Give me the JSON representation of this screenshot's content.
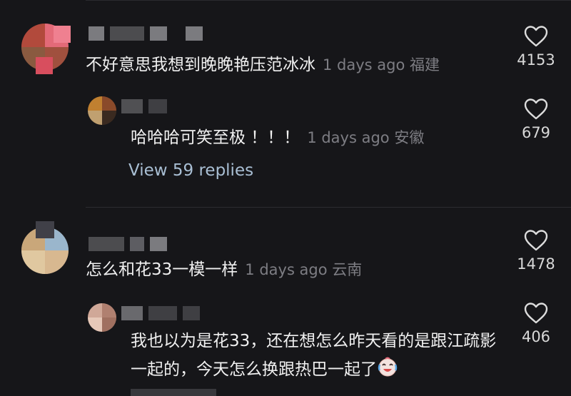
{
  "comments": [
    {
      "text": "不好意思我想到晚晚艳压范冰冰",
      "time": "1 days ago",
      "location": "福建",
      "likes": "4153"
    },
    {
      "text": "哈哈哈可笑至极 ！！！",
      "time": "1 days ago",
      "location": "安徽",
      "likes": "679"
    },
    {
      "text": "怎么和花33一模一样",
      "time": "1 days ago",
      "location": "云南",
      "likes": "1478"
    },
    {
      "text": "我也以为是花33，还在想怎么昨天看的是跟江疏影一起的，今天怎么换跟热巴一起了",
      "likes": "406"
    }
  ],
  "view_replies": "View 59 replies",
  "icons": {
    "like": "heart-outline-icon",
    "emoji": "crying-laughing-emoji"
  },
  "colors": {
    "background": "#161619",
    "link": "#a9bfd4",
    "meta": "#7d7d83"
  }
}
